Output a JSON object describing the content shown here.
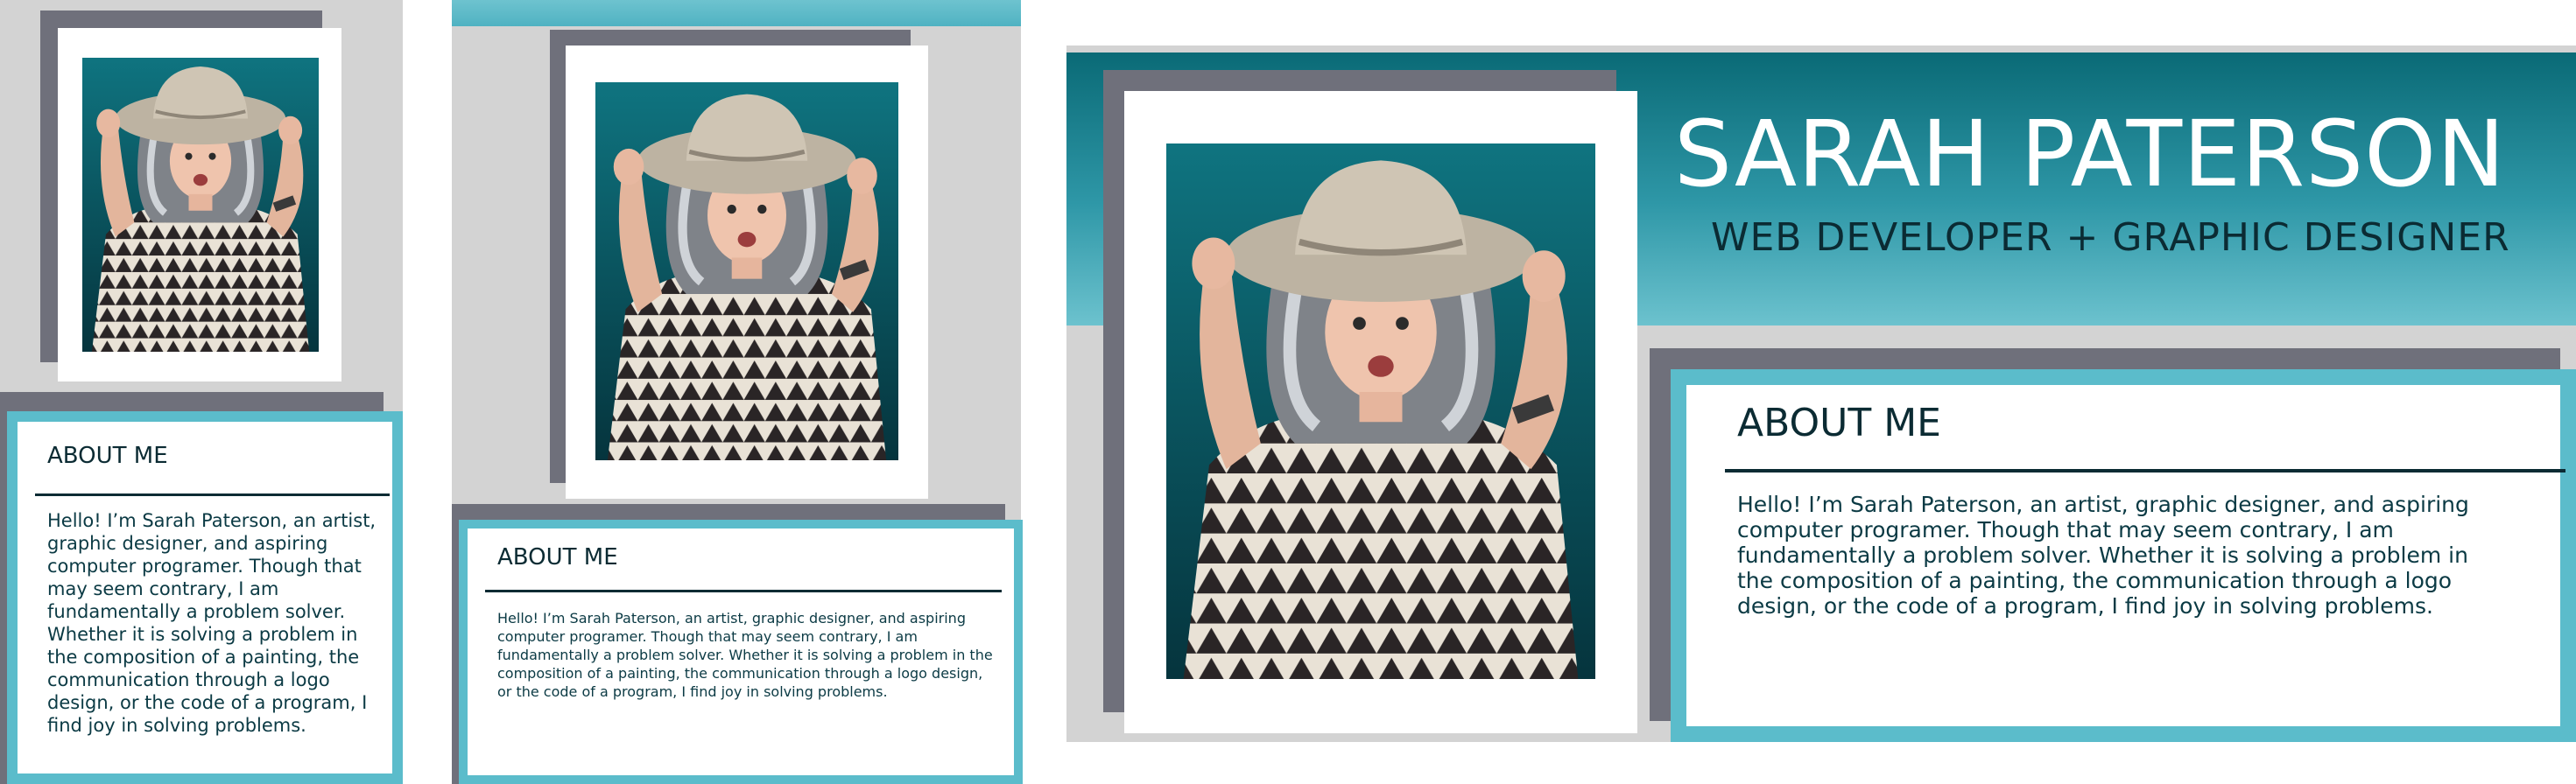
{
  "profile": {
    "name": "SARAH PATERSON",
    "subtitle": "WEB DEVELOPER + GRAPHIC DESIGNER",
    "photo_icon": "portrait-photo"
  },
  "about": {
    "title": "ABOUT ME",
    "body": "Hello! I’m Sarah Paterson, an artist, graphic designer, and aspiring computer programer. Though that may seem contrary, I am fundamentally a problem solver. Whether it is solving a problem in the composition of a painting, the communication through a logo design, or the code of a program, I find joy in solving problems."
  },
  "colors": {
    "teal_dark": "#0a5f6b",
    "teal_light": "#5bbccb",
    "slate": "#6f707b",
    "gray_bg": "#d3d3d3",
    "text_dark": "#0b2b33"
  }
}
